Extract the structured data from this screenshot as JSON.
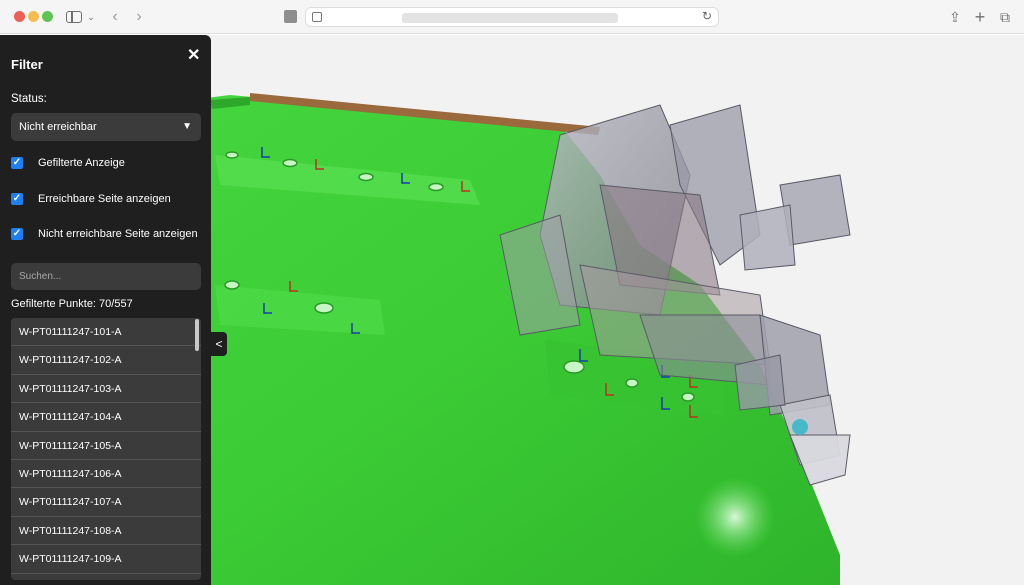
{
  "filter": {
    "title": "Filter",
    "status_label": "Status:",
    "status_value": "Nicht erreichbar",
    "checkboxes": [
      {
        "label": "Gefilterte Anzeige",
        "checked": true
      },
      {
        "label": "Erreichbare Seite anzeigen",
        "checked": true
      },
      {
        "label": "Nicht erreichbare Seite anzeigen",
        "checked": true
      }
    ],
    "search_placeholder": "Suchen...",
    "count_text": "Gefilterte Punkte: 70/557",
    "points": [
      "W-PT01111247-101-A",
      "W-PT01111247-102-A",
      "W-PT01111247-103-A",
      "W-PT01111247-104-A",
      "W-PT01111247-105-A",
      "W-PT01111247-106-A",
      "W-PT01111247-107-A",
      "W-PT01111247-108-A",
      "W-PT01111247-109-A"
    ],
    "close_glyph": "✕",
    "collapse_glyph": "<"
  },
  "colors": {
    "panel_bg": "#1f1f1f",
    "checkbox_accent": "#1e7ff0",
    "part_green": "#3fd13a"
  }
}
